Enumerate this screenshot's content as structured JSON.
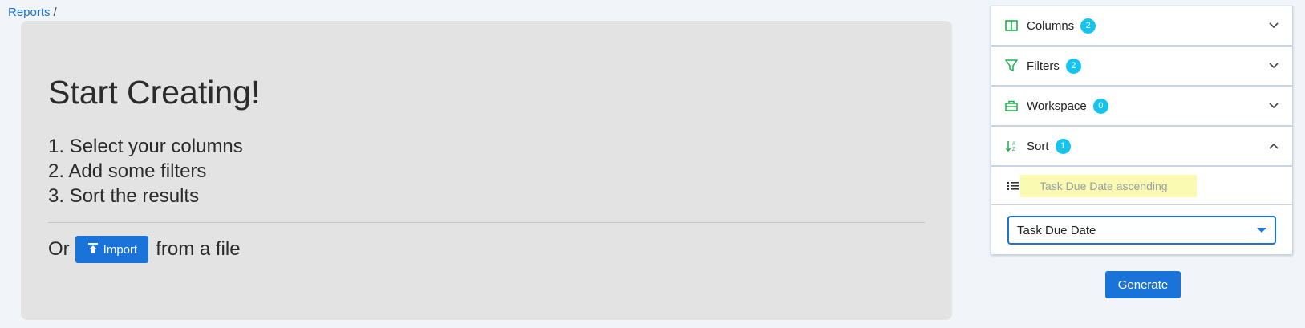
{
  "breadcrumb": {
    "link": "Reports",
    "separator": "/"
  },
  "main": {
    "title": "Start Creating!",
    "steps": [
      "1. Select your columns",
      "2. Add some filters",
      "3. Sort the results"
    ],
    "import_prefix": "Or",
    "import_label": "Import",
    "import_suffix": "from a file"
  },
  "panel": {
    "sections": [
      {
        "label": "Columns",
        "count": "2",
        "icon": "columns-icon",
        "expanded": false
      },
      {
        "label": "Filters",
        "count": "2",
        "icon": "filter-icon",
        "expanded": false
      },
      {
        "label": "Workspace",
        "count": "0",
        "icon": "briefcase-icon",
        "expanded": false
      },
      {
        "label": "Sort",
        "count": "1",
        "icon": "sort-icon",
        "expanded": true
      }
    ],
    "sort_item": "Task Due Date ascending",
    "sort_select_value": "Task Due Date"
  },
  "generate_label": "Generate",
  "colors": {
    "accent": "#1a73d9",
    "badge": "#14c4ef",
    "icon_green": "#17b34a",
    "highlight": "#fbfab2"
  }
}
